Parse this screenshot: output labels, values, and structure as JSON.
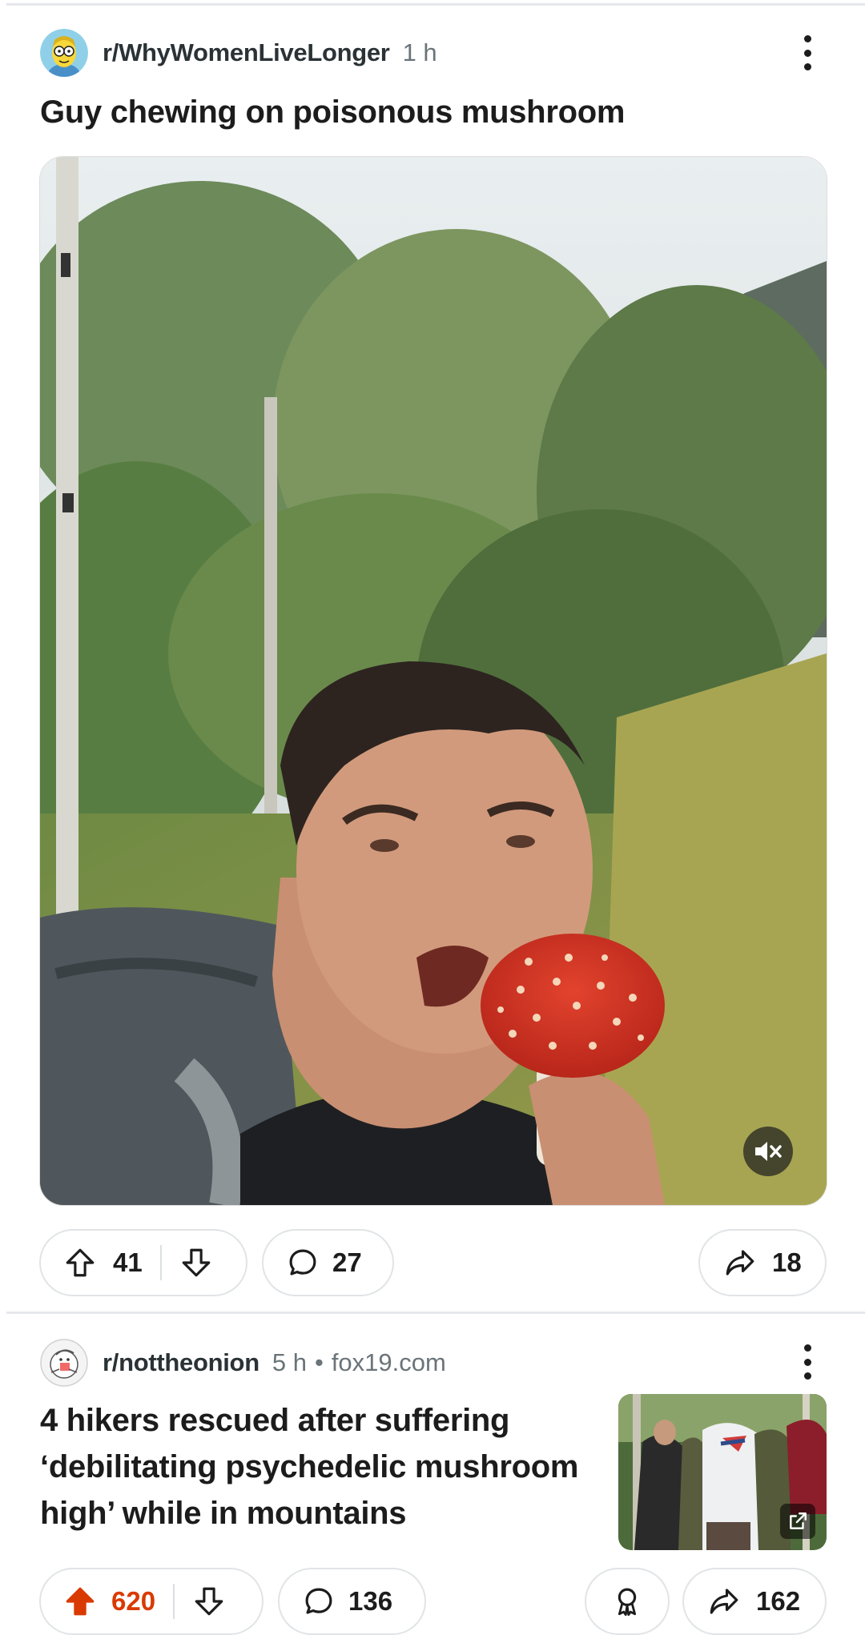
{
  "post1": {
    "subreddit": "r/WhyWomenLiveLonger",
    "age": "1 h",
    "title": "Guy chewing on poisonous mushroom",
    "upvotes": "41",
    "comments": "27",
    "shares": "18",
    "media": "video",
    "media_muted": true
  },
  "post2": {
    "subreddit": "r/nottheonion",
    "age": "5 h",
    "dot": "•",
    "domain": "fox19.com",
    "title": "4 hikers rescued after suffering ‘debilitating psychedelic mushroom high’ while in mountains",
    "upvotes": "620",
    "upvoted": true,
    "comments": "136",
    "shares": "162"
  },
  "icons": [
    "simpsons-avatar-icon",
    "more-vertical-icon",
    "mute-icon",
    "upvote-icon",
    "downvote-icon",
    "comment-icon",
    "share-icon",
    "award-icon",
    "external-link-icon",
    "nottheonion-avatar-icon"
  ],
  "colors": {
    "upvote_active": "#d93a00",
    "pill_border": "#e1e4e6",
    "meta_text": "#6a7479"
  }
}
